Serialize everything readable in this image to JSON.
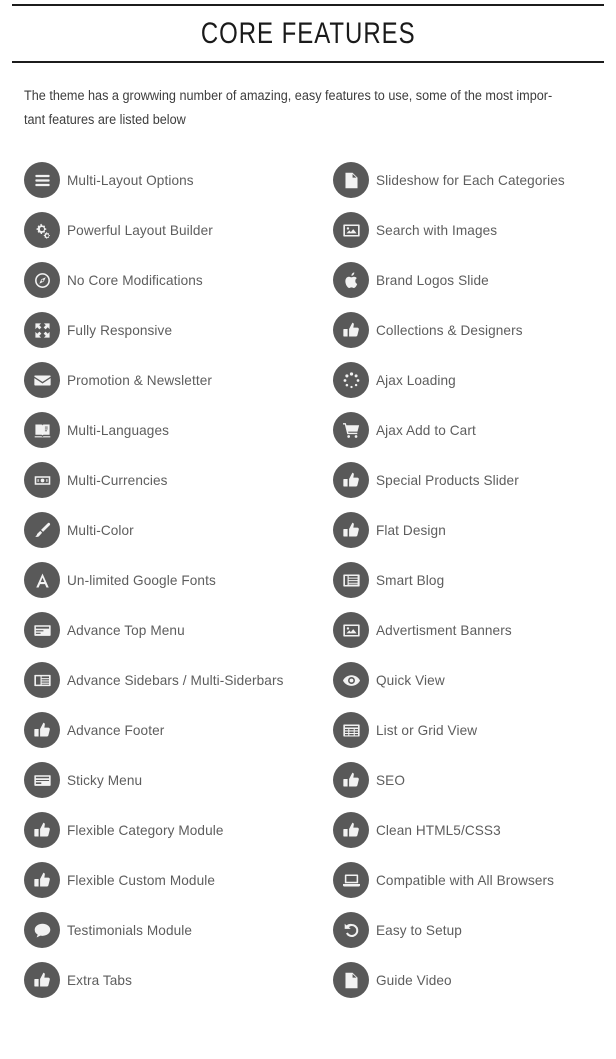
{
  "header": {
    "title": "CORE FEATURES"
  },
  "intro": {
    "text": "The theme has a growwing number of amazing, easy features to use, some of the most impor-tant features are listed below"
  },
  "colors": {
    "icon_circle": "#595959",
    "label_text": "#5d5d5d",
    "title_text": "#1a1a1a",
    "rule": "#1c1c1c",
    "page_background": "#ffffff"
  },
  "features": {
    "left_column": [
      {
        "label": "Multi-Layout Options",
        "icon": "list-icon"
      },
      {
        "label": "Powerful Layout Builder",
        "icon": "cogs-icon"
      },
      {
        "label": "No Core Modifications",
        "icon": "compass-icon"
      },
      {
        "label": "Fully Responsive",
        "icon": "expand-arrows-icon"
      },
      {
        "label": "Promotion & Newsletter",
        "icon": "envelope-icon"
      },
      {
        "label": "Multi-Languages",
        "icon": "language-book-icon"
      },
      {
        "label": "Multi-Currencies",
        "icon": "money-bill-icon"
      },
      {
        "label": "Multi-Color",
        "icon": "paint-brush-icon"
      },
      {
        "label": "Un-limited Google Fonts",
        "icon": "font-a-icon"
      },
      {
        "label": "Advance Top Menu",
        "icon": "top-menu-bar-icon"
      },
      {
        "label": "Advance Sidebars / Multi-Siderbars",
        "icon": "sidebar-layout-icon"
      },
      {
        "label": "Advance Footer",
        "icon": "thumbs-up-icon"
      },
      {
        "label": "Sticky Menu",
        "icon": "sticky-menu-bar-icon"
      },
      {
        "label": "Flexible Category Module",
        "icon": "thumbs-up-icon"
      },
      {
        "label": "Flexible Custom Module",
        "icon": "thumbs-up-icon"
      },
      {
        "label": "Testimonials Module",
        "icon": "comment-icon"
      },
      {
        "label": "Extra Tabs",
        "icon": "thumbs-up-icon"
      }
    ],
    "right_column": [
      {
        "label": "Slideshow for Each Categories",
        "icon": "file-image-icon"
      },
      {
        "label": "Search with Images",
        "icon": "picture-icon"
      },
      {
        "label": "Brand Logos Slide",
        "icon": "apple-logo-icon"
      },
      {
        "label": "Collections & Designers",
        "icon": "thumbs-up-icon"
      },
      {
        "label": "Ajax Loading",
        "icon": "spinner-icon"
      },
      {
        "label": "Ajax Add to Cart",
        "icon": "shopping-cart-icon"
      },
      {
        "label": "Special Products Slider",
        "icon": "thumbs-up-icon"
      },
      {
        "label": "Flat Design",
        "icon": "thumbs-up-icon"
      },
      {
        "label": "Smart Blog",
        "icon": "blog-list-icon"
      },
      {
        "label": "Advertisment Banners",
        "icon": "picture-icon"
      },
      {
        "label": "Quick View",
        "icon": "eye-icon"
      },
      {
        "label": "List or Grid View",
        "icon": "grid-icon"
      },
      {
        "label": "SEO",
        "icon": "thumbs-up-icon"
      },
      {
        "label": "Clean HTML5/CSS3",
        "icon": "thumbs-up-icon"
      },
      {
        "label": "Compatible with All Browsers",
        "icon": "laptop-icon"
      },
      {
        "label": "Easy to Setup",
        "icon": "undo-arrow-icon"
      },
      {
        "label": "Guide Video",
        "icon": "file-video-icon"
      }
    ]
  }
}
